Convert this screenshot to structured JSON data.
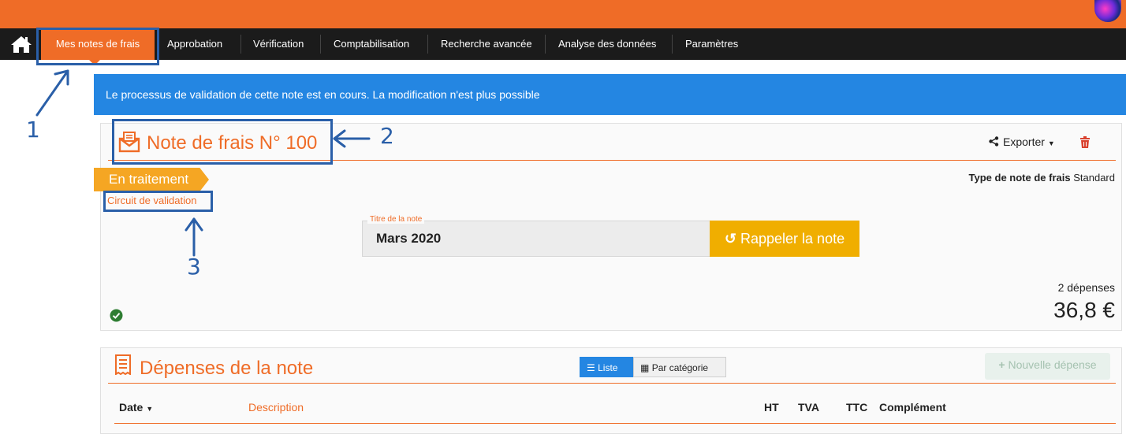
{
  "nav": {
    "items": [
      "Mes notes de frais",
      "Approbation",
      "Vérification",
      "Comptabilisation",
      "Recherche avancée",
      "Analyse des données",
      "Paramètres"
    ]
  },
  "alert": {
    "text": "Le processus de validation de cette note est en cours. La modification n'est plus possible"
  },
  "note": {
    "title": "Note de frais",
    "number": "N° 100",
    "export_label": "Exporter",
    "status": "En traitement",
    "circuit_link": "Circuit de validation",
    "type_label": "Type de note de frais",
    "type_value": "Standard",
    "titre_label": "Titre de la note",
    "titre_value": "Mars 2020",
    "recall_button": "Rappeler la note",
    "expenses_count": "2 dépenses",
    "total": "36,8 €"
  },
  "expenses": {
    "title": "Dépenses de la note",
    "view_list": "Liste",
    "view_category": "Par catégorie",
    "new_button": "Nouvelle dépense",
    "columns": [
      "Date",
      "Description",
      "HT",
      "TVA",
      "TTC",
      "Complément"
    ]
  },
  "annotations": [
    "1",
    "2",
    "3"
  ],
  "colors": {
    "brand_orange": "#ef6c27",
    "alert_blue": "#2486e2",
    "ribbon": "#f5a623",
    "recall": "#f0ae00",
    "annotation": "#2a5fa8"
  }
}
